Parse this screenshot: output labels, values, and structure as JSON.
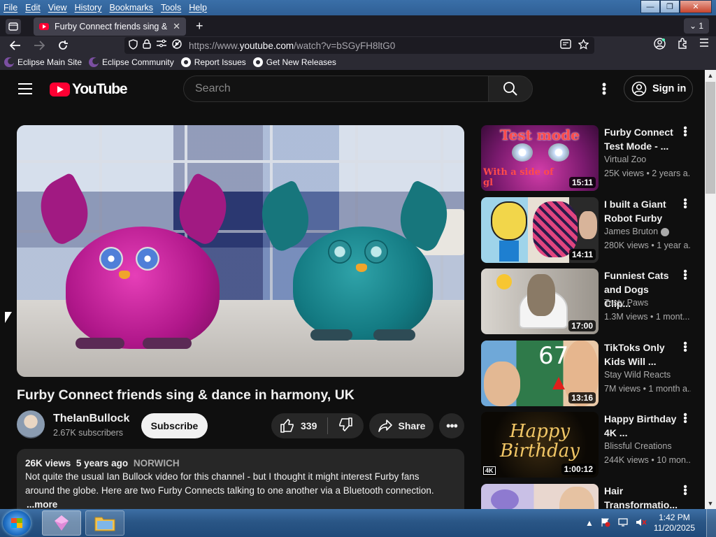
{
  "menubar": {
    "items": [
      "File",
      "Edit",
      "View",
      "History",
      "Bookmarks",
      "Tools",
      "Help"
    ],
    "window_controls": [
      "minimize",
      "maximize",
      "close"
    ]
  },
  "tabs": {
    "active_title": "Furby Connect friends sing & dance in harmony, UK",
    "tab_count": "1"
  },
  "navbar": {
    "url_prefix": "https://www.",
    "url_domain": "youtube.com",
    "url_suffix": "/watch?v=bSGyFH8ltG0"
  },
  "bookmarks": [
    {
      "label": "Eclipse Main Site",
      "icon": "eclipse-icon"
    },
    {
      "label": "Eclipse Community",
      "icon": "eclipse-icon"
    },
    {
      "label": "Report Issues",
      "icon": "github-icon"
    },
    {
      "label": "Get New Releases",
      "icon": "github-icon"
    }
  ],
  "youtube": {
    "logo_text": "YouTube",
    "search_placeholder": "Search",
    "signin_label": "Sign in"
  },
  "video": {
    "title": "Furby Connect friends sing & dance in harmony, UK",
    "channel": "TheIanBullock",
    "subscribers": "2.67K subscribers",
    "subscribe_label": "Subscribe",
    "likes": "339",
    "share_label": "Share",
    "views": "26K views",
    "age": "5 years ago",
    "tag": "NORWICH",
    "description_line1": "Not quite the usual Ian Bullock video for this channel - but I thought it might interest Furby fans",
    "description_line2": "around the globe. Here are two Furby Connects talking to one another via a Bluetooth connection.",
    "more_label": "...more"
  },
  "recommendations": [
    {
      "title": "Furby Connect Test Mode - ...",
      "channel": "Virtual Zoo",
      "meta": "25K views • 2 years a...",
      "duration": "15:11",
      "thumb_text": "Test mode",
      "verified": false
    },
    {
      "title": "I built a Giant Robot Furby",
      "channel": "James Bruton",
      "meta": "280K views • 1 year a...",
      "duration": "14:11",
      "thumb_text": "",
      "verified": true
    },
    {
      "title": "Funniest Cats and Dogs Clip...",
      "channel": "Tasty Paws",
      "meta": "1.3M views • 1 mont...",
      "duration": "17:00",
      "thumb_text": "",
      "verified": false
    },
    {
      "title": "TikToks Only Kids Will ...",
      "channel": "Stay Wild Reacts",
      "meta": "7M views • 1 month a...",
      "duration": "13:16",
      "thumb_text": "67",
      "verified": false
    },
    {
      "title": "Happy Birthday 4K ...",
      "channel": "Blissful Creations",
      "meta": "244K views • 10 mon...",
      "duration": "1:00:12",
      "thumb_text": "Happy Birthday",
      "verified": false
    },
    {
      "title": "Hair Transformatio...",
      "channel": "",
      "meta": "",
      "duration": "",
      "thumb_text": "",
      "verified": false
    }
  ],
  "taskbar": {
    "time": "1:42 PM",
    "date": "11/20/2025"
  }
}
